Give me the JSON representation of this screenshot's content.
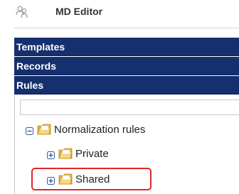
{
  "app": {
    "title": "MD Editor",
    "logo_icon": "people-icon"
  },
  "accordion": {
    "sections": [
      {
        "label": "Templates",
        "expanded": false
      },
      {
        "label": "Records",
        "expanded": false
      },
      {
        "label": "Rules",
        "expanded": true
      }
    ],
    "header_color": "#15306e"
  },
  "rules_panel": {
    "filter": {
      "value": "",
      "placeholder": ""
    },
    "tree": {
      "root": {
        "label": "Normalization rules",
        "state": "expanded",
        "icon": "folder-icon"
      },
      "children": [
        {
          "label": "Private",
          "state": "collapsed",
          "icon": "folder-icon"
        },
        {
          "label": "Shared",
          "state": "collapsed",
          "icon": "folder-icon",
          "highlighted": true
        }
      ]
    },
    "highlight_color": "#e0262a"
  }
}
